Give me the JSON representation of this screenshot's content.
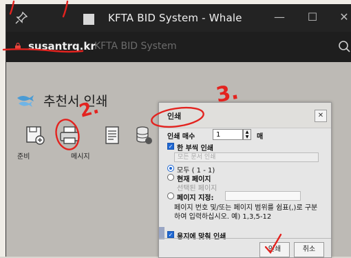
{
  "window": {
    "title": "KFTA BID System - Whale",
    "controls": {
      "minimize": "—",
      "maximize": "☐",
      "close": "✕"
    }
  },
  "address": {
    "domain": "susantrq.kr",
    "site_name": "KFTA BID System"
  },
  "page": {
    "title": "추천서 인쇄",
    "toolbar_labels": [
      "준비",
      "메시지"
    ]
  },
  "dialog": {
    "title": "인쇄",
    "close": "✕",
    "copies_label": "인쇄 매수",
    "copies_value": "1",
    "copies_unit": "매",
    "one_copy_label": "한 부씩 인쇄",
    "print_all_docs_placeholder": "모든 문서 인쇄",
    "all_label": "모두 ( 1 - 1)",
    "current_page_label": "현재 페이지",
    "selected_pages_label": "선택된 페이지",
    "page_range_label": "페이지 지정:",
    "help_text": "페이지 번호 및/또는 페이지 범위를 쉼표(,)로 구분하여 입력하십시오. 예) 1,3,5-12",
    "fit_to_paper_label": "용지에 맞춰 인쇄",
    "print_button": "인쇄",
    "cancel_button": "취소"
  },
  "annotations": {
    "marks": [
      "2.",
      "3."
    ],
    "ink_color": "#e3231f"
  }
}
